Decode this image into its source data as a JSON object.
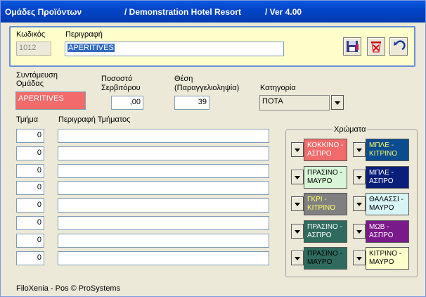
{
  "title": {
    "app": "Ομάδες Προϊόντων",
    "hotel": "/ Demonstration Hotel Resort",
    "version": "/ Ver  4.00"
  },
  "top_panel": {
    "code_label": "Κωδικός",
    "code_value": "1012",
    "description_label": "Περιγραφή",
    "description_value": "APERITIVES"
  },
  "toolbar": {
    "save_icon": "floppy-save-icon",
    "cancel_icon": "bucket-cancel-icon",
    "undo_icon": "undo-arrow-icon"
  },
  "form": {
    "short_label_line1": "Συντόμευση",
    "short_label_line2": "Ομάδας",
    "short_value": "APERITIVES",
    "short_bg": "#f26b6b",
    "percent_label_line1": "Ποσοστό",
    "percent_label_line2": "Σερβιτόρου",
    "percent_value": ",00",
    "position_label_line1": "Θέση",
    "position_label_line2": "(Παραγγελιοληψία)",
    "position_value": "39",
    "category_label": "Κατηγορία",
    "category_value": "ΠΟΤΑ"
  },
  "sections": {
    "dept_label": "Τμήμα",
    "dept_desc_label": "Περιγραφή Τμήματος",
    "rows": [
      {
        "dept": "0",
        "desc": ""
      },
      {
        "dept": "0",
        "desc": ""
      },
      {
        "dept": "0",
        "desc": ""
      },
      {
        "dept": "0",
        "desc": ""
      },
      {
        "dept": "0",
        "desc": ""
      },
      {
        "dept": "0",
        "desc": ""
      },
      {
        "dept": "0",
        "desc": ""
      },
      {
        "dept": "0",
        "desc": ""
      }
    ]
  },
  "colors": {
    "title": "Χρώματα",
    "left": [
      {
        "line1": "ΚΟΚΚΙΝΟ -",
        "line2": "ΑΣΠΡΟ",
        "bg": "#f26b6b",
        "fg": "#ffffff"
      },
      {
        "line1": "ΠΡΑΣΙΝΟ -",
        "line2": "ΜΑΥΡΟ",
        "bg": "#d8f5d8",
        "fg": "#000000"
      },
      {
        "line1": "ΓΚΡΙ -",
        "line2": "ΚΙΤΡΙΝΟ",
        "bg": "#808080",
        "fg": "#ffff66"
      },
      {
        "line1": "ΠΡΑΣΙΝΟ -",
        "line2": "ΑΣΠΡΟ",
        "bg": "#2e6b5e",
        "fg": "#ffffff"
      },
      {
        "line1": "ΠΡΑΣΙΝΟ -",
        "line2": "ΜΑΥΡΟ",
        "bg": "#2e6b5e",
        "fg": "#000000"
      }
    ],
    "right": [
      {
        "line1": "ΜΠΛΕ -",
        "line2": "ΚΙΤΡΙΝΟ",
        "bg": "#0a4c8f",
        "fg": "#ffff66"
      },
      {
        "line1": "ΜΠΛΕ -",
        "line2": "ΑΣΠΡΟ",
        "bg": "#0a1f7a",
        "fg": "#ffffff"
      },
      {
        "line1": "ΘΑΛΑΣΣΙ -",
        "line2": "ΜΑΥΡΟ",
        "bg": "#d8f5f5",
        "fg": "#000000"
      },
      {
        "line1": "ΜΩΒ -",
        "line2": "ΑΣΠΡΟ",
        "bg": "#7a1a8a",
        "fg": "#ffffff"
      },
      {
        "line1": "ΚΙΤΡΙΝΟ -",
        "line2": "ΜΑΥΡΟ",
        "bg": "#ffffcc",
        "fg": "#000000"
      }
    ]
  },
  "footer": {
    "text": "FiloXenia - Pos  © ProSystems"
  }
}
